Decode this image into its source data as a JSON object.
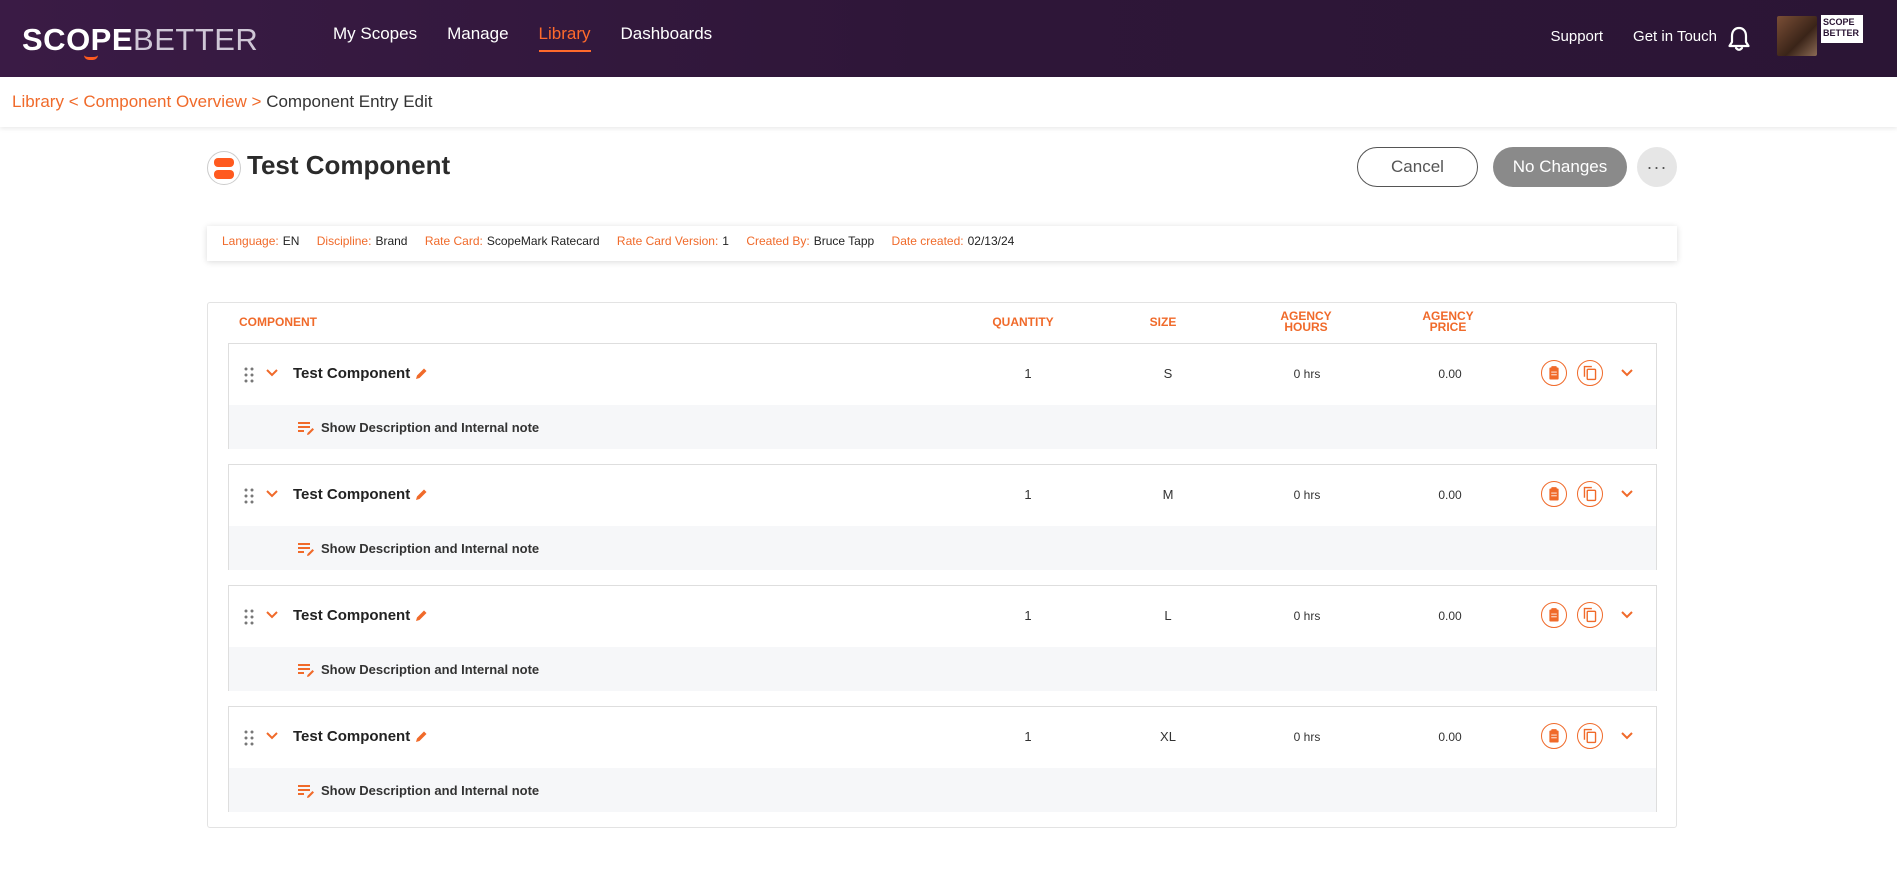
{
  "app": {
    "logo_scope": "SCOPE",
    "logo_better": "BETTER",
    "org_logo_text": "SCOPE BETTER"
  },
  "nav": {
    "items": [
      {
        "label": "My Scopes"
      },
      {
        "label": "Manage"
      },
      {
        "label": "Library",
        "active": true
      },
      {
        "label": "Dashboards"
      }
    ],
    "support": "Support",
    "contact": "Get in Touch"
  },
  "breadcrumb": {
    "library": "Library",
    "sep1": " < ",
    "overview": "Component Overview",
    "sep2": " > ",
    "current": "Component Entry Edit"
  },
  "header": {
    "title": "Test Component",
    "cancel_label": "Cancel",
    "no_changes_label": "No Changes",
    "more_label": "···"
  },
  "meta": {
    "language_label": "Language:",
    "language": "EN",
    "discipline_label": "Discipline:",
    "discipline": "Brand",
    "rate_card_label": "Rate Card:",
    "rate_card": "ScopeMark Ratecard",
    "rate_card_version_label": "Rate Card Version:",
    "rate_card_version": "1",
    "created_by_label": "Created By:",
    "created_by": "Bruce Tapp",
    "date_created_label": "Date created:",
    "date_created": "02/13/24"
  },
  "table": {
    "columns": {
      "component": "COMPONENT",
      "quantity": "QUANTITY",
      "size": "SIZE",
      "agency_hours_1": "AGENCY",
      "agency_hours_2": "HOURS",
      "agency_price_1": "AGENCY",
      "agency_price_2": "PRICE"
    },
    "rows": [
      {
        "name": "Test Component",
        "quantity": "1",
        "size": "S",
        "hours": "0 hrs",
        "price": "0.00",
        "desc_label": "Show Description and Internal note"
      },
      {
        "name": "Test Component",
        "quantity": "1",
        "size": "M",
        "hours": "0 hrs",
        "price": "0.00",
        "desc_label": "Show Description and Internal note"
      },
      {
        "name": "Test Component",
        "quantity": "1",
        "size": "L",
        "hours": "0 hrs",
        "price": "0.00",
        "desc_label": "Show Description and Internal note"
      },
      {
        "name": "Test Component",
        "quantity": "1",
        "size": "XL",
        "hours": "0 hrs",
        "price": "0.00",
        "desc_label": "Show Description and Internal note"
      }
    ]
  },
  "colors": {
    "accent": "#f06a2a",
    "topbar": "#2e1638",
    "disabled_button": "#8a8a8a"
  },
  "icons": {
    "bell": "bell-icon",
    "drag": "drag-handle-icon",
    "expand": "chevron-down-icon",
    "edit": "pencil-icon",
    "notes": "clipboard-icon",
    "duplicate": "copy-icon",
    "description": "notes-edit-icon"
  }
}
